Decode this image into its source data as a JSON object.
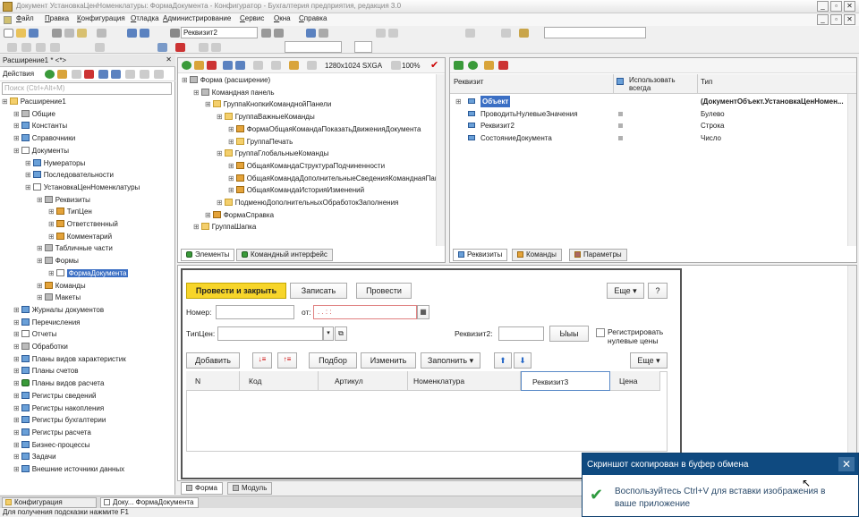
{
  "window": {
    "title": "Документ УстановкаЦенНоменклатуры: ФормаДокумента - Конфигуратор - Бухгалтерия предприятия, редакция 3.0"
  },
  "menu": [
    "Файл",
    "Правка",
    "Конфигурация",
    "Отладка",
    "Администрирование",
    "Сервис",
    "Окна",
    "Справка"
  ],
  "toolbar": {
    "attr_combo": "Реквизит2",
    "resolution": "1280x1024 SXGA",
    "zoom": "100%"
  },
  "left": {
    "tab_title": "Расширение1 * <*>",
    "actions_label": "Действия",
    "search_placeholder": "Поиск (Ctrl+Alt+M)",
    "tree": [
      {
        "text": "Расширение1",
        "lvl": 0,
        "icon": "folder"
      },
      {
        "text": "Общие",
        "lvl": 1,
        "icon": "grey"
      },
      {
        "text": "Константы",
        "lvl": 1,
        "icon": "blue"
      },
      {
        "text": "Справочники",
        "lvl": 1,
        "icon": "blue"
      },
      {
        "text": "Документы",
        "lvl": 1,
        "icon": "doc"
      },
      {
        "text": "Нумераторы",
        "lvl": 2,
        "icon": "blue"
      },
      {
        "text": "Последовательности",
        "lvl": 2,
        "icon": "blue"
      },
      {
        "text": "УстановкаЦенНоменклатуры",
        "lvl": 2,
        "icon": "doc"
      },
      {
        "text": "Реквизиты",
        "lvl": 3,
        "icon": "grey"
      },
      {
        "text": "ТипЦен",
        "lvl": 4,
        "icon": "attr"
      },
      {
        "text": "Ответственный",
        "lvl": 4,
        "icon": "attr"
      },
      {
        "text": "Комментарий",
        "lvl": 4,
        "icon": "attr"
      },
      {
        "text": "Табличные части",
        "lvl": 3,
        "icon": "grey"
      },
      {
        "text": "Формы",
        "lvl": 3,
        "icon": "grey"
      },
      {
        "text": "ФормаДокумента",
        "lvl": 4,
        "icon": "doc",
        "selected": true
      },
      {
        "text": "Команды",
        "lvl": 3,
        "icon": "attr"
      },
      {
        "text": "Макеты",
        "lvl": 3,
        "icon": "grey"
      },
      {
        "text": "Журналы документов",
        "lvl": 1,
        "icon": "blue"
      },
      {
        "text": "Перечисления",
        "lvl": 1,
        "icon": "blue"
      },
      {
        "text": "Отчеты",
        "lvl": 1,
        "icon": "doc"
      },
      {
        "text": "Обработки",
        "lvl": 1,
        "icon": "grey"
      },
      {
        "text": "Планы видов характеристик",
        "lvl": 1,
        "icon": "blue"
      },
      {
        "text": "Планы счетов",
        "lvl": 1,
        "icon": "blue"
      },
      {
        "text": "Планы видов расчета",
        "lvl": 1,
        "icon": "green"
      },
      {
        "text": "Регистры сведений",
        "lvl": 1,
        "icon": "blue"
      },
      {
        "text": "Регистры накопления",
        "lvl": 1,
        "icon": "blue"
      },
      {
        "text": "Регистры бухгалтерии",
        "lvl": 1,
        "icon": "blue"
      },
      {
        "text": "Регистры расчета",
        "lvl": 1,
        "icon": "blue"
      },
      {
        "text": "Бизнес-процессы",
        "lvl": 1,
        "icon": "blue"
      },
      {
        "text": "Задачи",
        "lvl": 1,
        "icon": "blue"
      },
      {
        "text": "Внешние источники данных",
        "lvl": 1,
        "icon": "blue"
      }
    ]
  },
  "elements": {
    "tree": [
      {
        "text": "Форма (расширение)",
        "lvl": 0,
        "icon": "grey"
      },
      {
        "text": "Командная панель",
        "lvl": 1,
        "icon": "grey"
      },
      {
        "text": "ГруппаКнопкиКоманднойПанели",
        "lvl": 2,
        "icon": "folder"
      },
      {
        "text": "ГруппаВажныеКоманды",
        "lvl": 3,
        "icon": "folder"
      },
      {
        "text": "ФормаОбщаяКомандаПоказатьДвиженияДокумента",
        "lvl": 4,
        "icon": "attr"
      },
      {
        "text": "ГруппаПечать",
        "lvl": 4,
        "icon": "folder"
      },
      {
        "text": "ГруппаГлобальныеКоманды",
        "lvl": 3,
        "icon": "folder"
      },
      {
        "text": "ОбщаяКомандаСтруктураПодчиненности",
        "lvl": 4,
        "icon": "attr"
      },
      {
        "text": "ОбщаяКомандаДополнительныеСведенияКоманднаяПане",
        "lvl": 4,
        "icon": "attr"
      },
      {
        "text": "ОбщаяКомандаИсторияИзменений",
        "lvl": 4,
        "icon": "attr"
      },
      {
        "text": "ПодменюДополнительныхОбработокЗаполнения",
        "lvl": 3,
        "icon": "folder"
      },
      {
        "text": "ФормаСправка",
        "lvl": 2,
        "icon": "attr"
      },
      {
        "text": "ГруппаШапка",
        "lvl": 1,
        "icon": "folder"
      }
    ],
    "tabs": [
      "Элементы",
      "Командный интерфейс"
    ]
  },
  "props": {
    "headers": [
      "Реквизит",
      "Использовать всегда",
      "Тип"
    ],
    "rows": [
      {
        "name": "Объект",
        "type": "(ДокументОбъект.УстановкаЦенНомен...",
        "always": false,
        "bold": true,
        "selected": true
      },
      {
        "name": "ПроводитьНулевыеЗначения",
        "type": "Булево",
        "always": true
      },
      {
        "name": "Реквизит2",
        "type": "Строка",
        "always": true
      },
      {
        "name": "СостояниеДокумента",
        "type": "Число",
        "always": true
      }
    ],
    "tabs": [
      "Реквизиты",
      "Команды",
      "Параметры"
    ]
  },
  "form": {
    "buttons": {
      "post_close": "Провести и закрыть",
      "write": "Записать",
      "post": "Провести",
      "more": "Еще",
      "help": "?"
    },
    "number_label": "Номер:",
    "from_label": "от:",
    "from_value": ". .  : :",
    "price_type_label": "ТипЦен:",
    "attr2_label": "Реквизит2:",
    "yy_button": "Ыыы",
    "register_zero": "Регистрировать нулевые цены",
    "table_buttons": {
      "add": "Добавить",
      "select": "Подбор",
      "change": "Изменить",
      "fill": "Заполнить",
      "more": "Еще"
    },
    "columns": [
      "N",
      "Код",
      "Артикул",
      "Номенклатура",
      "Реквизит3",
      "Цена"
    ],
    "tabs": [
      "Форма",
      "Модуль"
    ]
  },
  "notification": {
    "title": "Скриншот скопирован в буфер обмена",
    "body": "Воспользуйтесь Ctrl+V для вставки изображения в ваше приложение"
  },
  "taskbar": {
    "items": [
      "Конфигурация",
      "Доку... ФормаДокумента"
    ]
  },
  "status": "Для получения подсказки нажмите F1"
}
